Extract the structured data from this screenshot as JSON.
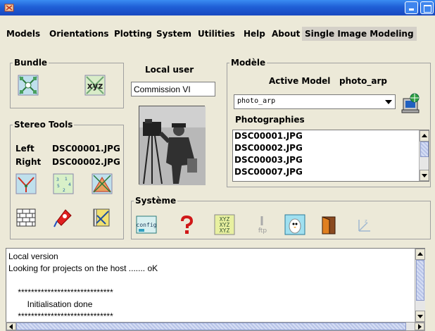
{
  "menu": {
    "items": [
      "Models",
      "Orientations",
      "Plotting",
      "System",
      "Utilities",
      "Help",
      "About",
      "Single Image Modeling"
    ]
  },
  "bundle": {
    "legend": "Bundle",
    "xyz_label": "xyz"
  },
  "local_user": {
    "label": "Local user",
    "value": "Commission VI"
  },
  "stereo": {
    "legend": "Stereo Tools",
    "left_label": "Left",
    "left_value": "DSC00001.JPG",
    "right_label": "Right",
    "right_value": "DSC00002.JPG"
  },
  "model": {
    "legend": "Modèle",
    "active_label": "Active Model",
    "active_value": "photo_arp",
    "combo_value": "photo_arp",
    "photos_label": "Photographies",
    "photos": [
      "DSC00001.JPG",
      "DSC00002.JPG",
      "DSC00003.JPG",
      "DSC00007.JPG"
    ]
  },
  "system": {
    "legend": "Système",
    "config_label": "config",
    "ftp_label": "ftp"
  },
  "console": {
    "lines": [
      "Local version",
      "Looking for projects on the host ....... oK",
      "",
      "    *****************************",
      "        Initialisation done",
      "    *****************************"
    ]
  },
  "colors": {
    "titlebar": "#1f5fd6",
    "window_bg": "#ece9d8",
    "scroll_thumb": "#b8c4e8"
  }
}
